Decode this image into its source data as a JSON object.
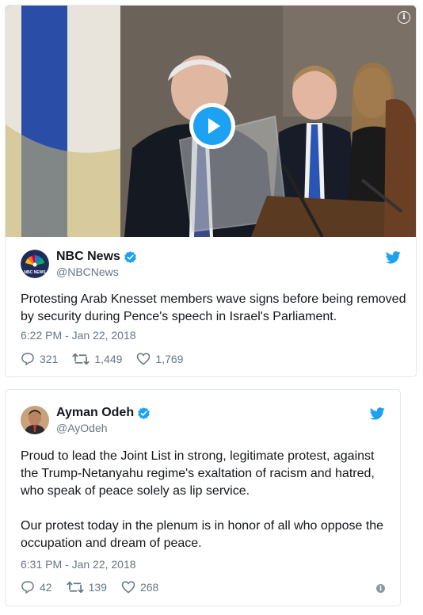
{
  "tweets": [
    {
      "author": {
        "name": "NBC News",
        "handle": "@NBCNews",
        "verified": true
      },
      "media": {
        "type": "video",
        "info_label": "i"
      },
      "paragraphs": [
        "Protesting Arab Knesset members wave signs before being removed by security during Pence's speech in Israel's Parliament."
      ],
      "timestamp": "6:22 PM - Jan 22, 2018",
      "stats": {
        "replies": "321",
        "retweets": "1,449",
        "likes": "1,769"
      }
    },
    {
      "author": {
        "name": "Ayman Odeh",
        "handle": "@AyOdeh",
        "verified": true
      },
      "paragraphs": [
        "Proud to lead the Joint List in strong, legitimate protest, against the Trump-Netanyahu regime's exaltation of racism and hatred, who speak of peace solely as lip service.",
        "Our protest today in the plenum is in honor of all who oppose the occupation and dream of peace."
      ],
      "timestamp": "6:31 PM - Jan 22, 2018",
      "stats": {
        "replies": "42",
        "retweets": "139",
        "likes": "268"
      },
      "info_label": "i"
    }
  ],
  "colors": {
    "accent": "#1da1f2",
    "text": "#14171a",
    "secondary": "#657786",
    "border": "#e1e8ed"
  },
  "icons": [
    "play-icon",
    "info-icon",
    "verified-badge-icon",
    "twitter-bird-icon",
    "reply-icon",
    "retweet-icon",
    "like-icon"
  ]
}
